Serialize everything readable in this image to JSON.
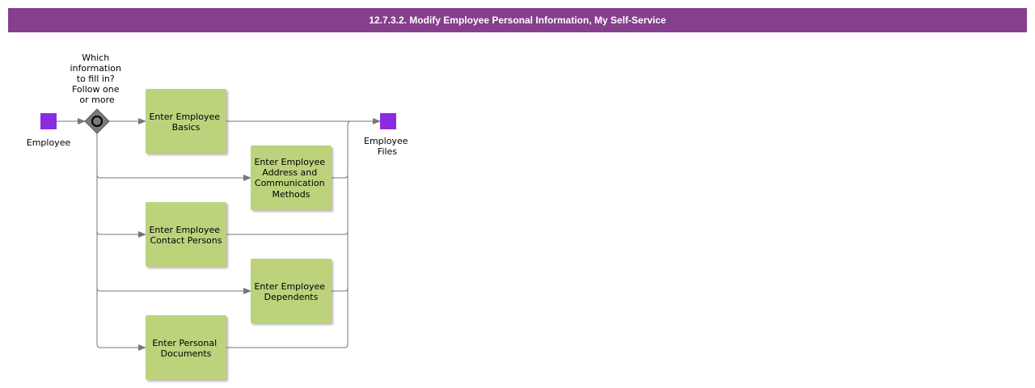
{
  "header": {
    "title": "12.7.3.2. Modify Employee Personal Information, My Self-Service"
  },
  "colors": {
    "header_bg": "#863f8c",
    "event": "#8a2be2",
    "task_fill": "#bcd37c",
    "connector": "#777777",
    "gateway": "#7a7a7a"
  },
  "diagram": {
    "start_event": {
      "label": "Employee"
    },
    "gateway": {
      "label_lines": [
        "Which",
        "information",
        "to fill in?",
        "Follow one",
        "or more"
      ]
    },
    "end_event": {
      "label_lines": [
        "Employee",
        "Files"
      ]
    },
    "tasks": [
      {
        "label_lines": [
          "Enter Employee",
          "Basics"
        ]
      },
      {
        "label_lines": [
          "Enter Employee",
          "Address and",
          "Communication",
          "Methods"
        ]
      },
      {
        "label_lines": [
          "Enter Employee",
          "Contact Persons"
        ]
      },
      {
        "label_lines": [
          "Enter Employee",
          "Dependents"
        ]
      },
      {
        "label_lines": [
          "Enter Personal",
          "Documents"
        ]
      }
    ]
  }
}
